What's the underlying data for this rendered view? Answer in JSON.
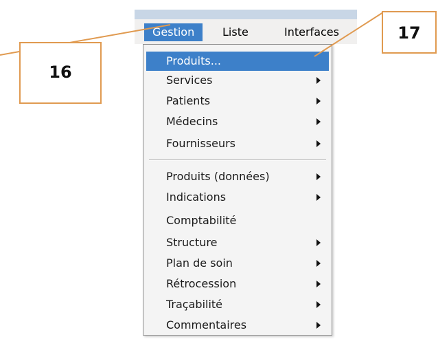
{
  "menubar": {
    "items": [
      {
        "label": "Gestion",
        "active": true
      },
      {
        "label": "Liste",
        "active": false
      },
      {
        "label": "Interfaces",
        "active": false
      }
    ]
  },
  "menu": {
    "items": [
      {
        "label": "Produits...",
        "highlighted": true,
        "has_submenu": false
      },
      {
        "label": "Services",
        "highlighted": false,
        "has_submenu": true
      },
      {
        "label": "Patients",
        "highlighted": false,
        "has_submenu": true
      },
      {
        "label": "Médecins",
        "highlighted": false,
        "has_submenu": true
      },
      {
        "label": "Fournisseurs",
        "highlighted": false,
        "has_submenu": true
      },
      {
        "label": "Produits (données)",
        "highlighted": false,
        "has_submenu": true
      },
      {
        "label": "Indications",
        "highlighted": false,
        "has_submenu": true
      },
      {
        "label": "Comptabilité",
        "highlighted": false,
        "has_submenu": false
      },
      {
        "label": "Structure",
        "highlighted": false,
        "has_submenu": true
      },
      {
        "label": "Plan de soin",
        "highlighted": false,
        "has_submenu": true
      },
      {
        "label": "Rétrocession",
        "highlighted": false,
        "has_submenu": true
      },
      {
        "label": "Traçabilité",
        "highlighted": false,
        "has_submenu": true
      },
      {
        "label": "Commentaires",
        "highlighted": false,
        "has_submenu": true
      }
    ]
  },
  "callouts": [
    {
      "number": "16"
    },
    {
      "number": "17"
    }
  ],
  "colors": {
    "highlight": "#3d80c9",
    "callout_border": "#e09a50",
    "menu_background": "#f4f4f4"
  }
}
